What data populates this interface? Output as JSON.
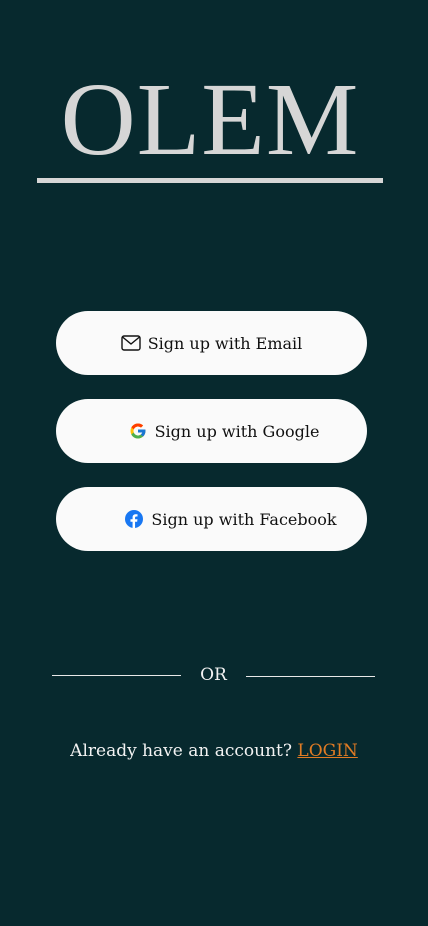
{
  "app": {
    "logo_text": "OLEM"
  },
  "signup": {
    "email_label": "Sign up with Email",
    "google_label": "Sign up with Google",
    "facebook_label": "Sign up with Facebook"
  },
  "divider": {
    "text": "OR"
  },
  "login": {
    "prompt": "Already have an account? ",
    "link_label": "LOGIN"
  },
  "icons": {
    "email": "mail-icon",
    "google": "google-icon",
    "facebook": "facebook-icon"
  },
  "colors": {
    "background": "#07292e",
    "button_bg": "#fafafa",
    "logo": "#d6d6d6",
    "link_accent": "#e07b24",
    "facebook_blue": "#1877f2"
  }
}
